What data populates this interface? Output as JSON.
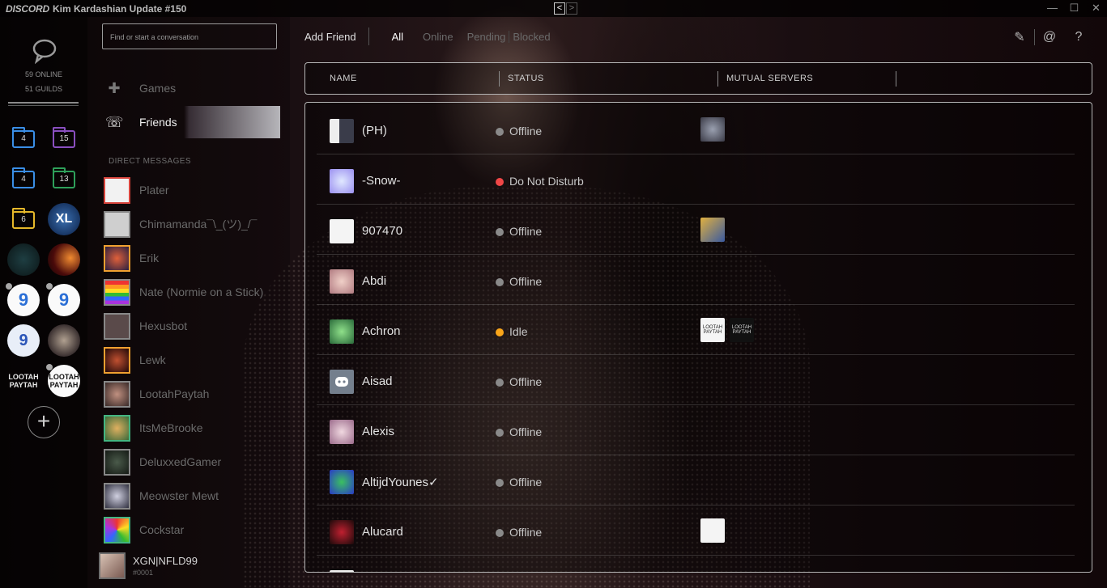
{
  "titlebar": {
    "brand": "DISCORD",
    "title": "Kim Kardashian Update #150",
    "nav_back": "<",
    "nav_forward": ">",
    "minimize": "—",
    "maximize": "☐",
    "close": "✕"
  },
  "rail": {
    "online": "59 ONLINE",
    "guilds": "51 GUILDS",
    "folders": [
      {
        "count": "4",
        "color": "#3a8ee6"
      },
      {
        "count": "15",
        "color": "#8a4fc0"
      },
      {
        "count": "4",
        "color": "#3a8ee6"
      },
      {
        "count": "13",
        "color": "#2ea05a"
      },
      {
        "count": "6",
        "color": "#e5b82a"
      }
    ],
    "servers": [
      {
        "label": "XL"
      },
      {
        "label": ""
      },
      {
        "label": ""
      },
      {
        "label": "9"
      },
      {
        "label": "9"
      },
      {
        "label": "9"
      },
      {
        "label": ""
      },
      {
        "label": "LOOTAH PAYTAH"
      },
      {
        "label": "LOOTAH PAYTAH"
      }
    ],
    "add_server": "+"
  },
  "dm": {
    "search_placeholder": "Find or start a conversation",
    "games_label": "Games",
    "friends_label": "Friends",
    "heading": "DIRECT MESSAGES",
    "items": [
      {
        "name": "Plater",
        "border": "#d8443c"
      },
      {
        "name": "Chimamanda¯\\_(ツ)_/¯",
        "border": "#888888"
      },
      {
        "name": "Erik",
        "border": "#f0a030"
      },
      {
        "name": "Nate (Normie on a Stick)",
        "border": "#888888"
      },
      {
        "name": "Hexusbot",
        "border": "#888888"
      },
      {
        "name": "Lewk",
        "border": "#f0a030"
      },
      {
        "name": "LootahPaytah",
        "border": "#888888"
      },
      {
        "name": "ItsMeBrooke",
        "border": "#43b581"
      },
      {
        "name": "DeluxxedGamer",
        "border": "#888888"
      },
      {
        "name": "Meowster Mewt",
        "border": "#888888"
      },
      {
        "name": "Cockstar",
        "border": "#43b581"
      }
    ],
    "me": {
      "name": "XGN|NFLD99",
      "tag": "#0001"
    }
  },
  "main": {
    "tabs": {
      "add_friend": "Add Friend",
      "all": "All",
      "online": "Online",
      "pending": "Pending",
      "blocked": "Blocked"
    },
    "icons": [
      "new-group-icon",
      "mention-icon",
      "help-icon"
    ],
    "icon_glyphs": {
      "new_group": "✎",
      "mention": "@",
      "help": "?"
    },
    "columns": {
      "name": "NAME",
      "status": "STATUS",
      "mutual": "MUTUAL SERVERS"
    },
    "friends": [
      {
        "name": "(PH)",
        "status": "Offline",
        "status_color": "#8a8a8a",
        "avatar": "#6b6e80",
        "mutual": [
          "#5a5a66"
        ]
      },
      {
        "name": "-Snow-",
        "status": "Do Not Disturb",
        "status_color": "#f04747",
        "avatar": "#a6a0f0",
        "mutual": []
      },
      {
        "name": "907470",
        "status": "Offline",
        "status_color": "#8a8a8a",
        "avatar": "#f2f2f2",
        "mutual": [
          "#c79a40"
        ]
      },
      {
        "name": "Abdi",
        "status": "Offline",
        "status_color": "#8a8a8a",
        "avatar": "#d9b7b0",
        "mutual": []
      },
      {
        "name": "Achron",
        "status": "Idle",
        "status_color": "#faa61a",
        "avatar": "#4a9a5a",
        "mutual": [
          "#f5f5f5",
          "#111111"
        ]
      },
      {
        "name": "Aisad",
        "status": "Offline",
        "status_color": "#8a8a8a",
        "avatar": "#747f8d",
        "mutual": []
      },
      {
        "name": "Alexis",
        "status": "Offline",
        "status_color": "#8a8a8a",
        "avatar": "#d8b0c0",
        "mutual": []
      },
      {
        "name": "AltijdYounes✓",
        "status": "Offline",
        "status_color": "#8a8a8a",
        "avatar": "#3f62d8",
        "mutual": []
      },
      {
        "name": "Alucard",
        "status": "Offline",
        "status_color": "#8a8a8a",
        "avatar": "#7a1a20",
        "mutual": [
          "#f2f2f2"
        ]
      }
    ]
  }
}
